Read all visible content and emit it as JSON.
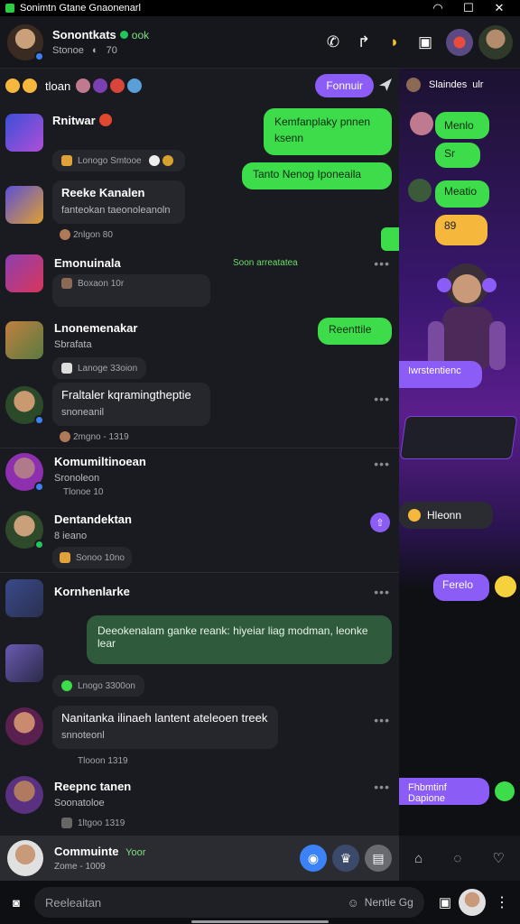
{
  "window": {
    "title": "Sonimtn Gtane Gnaonenarl"
  },
  "header": {
    "name": "Sonontkats",
    "tag": "ook",
    "subtitle": "Stonoe",
    "count": "70"
  },
  "filter": {
    "label": "tloan",
    "button": "Fonnuir"
  },
  "messages": [
    {
      "name": "Rnitwar",
      "meta": "Lonogo Smtooe"
    },
    {
      "name": "Reeke Kanalen",
      "sub": "fanteokan taeonoleanoln",
      "meta": "2nlgon 80"
    },
    {
      "name": "Emonuinala",
      "sub": "Soon arreatatea",
      "meta": "Boxaon 10r"
    },
    {
      "name": "Lnonemenakar",
      "sub": "Sbrafata",
      "meta": "Lanoge 33oion"
    },
    {
      "name": "Fraltaler kqramingtheptie",
      "sub": "snoneanil",
      "meta": "2mgno - 1319"
    },
    {
      "name": "Komumiltinoean",
      "sub": "Sronoleon",
      "meta": "Tlonoe 10"
    },
    {
      "name": "Dentandektan",
      "sub": "8 ieano",
      "meta": "Sonoo 10no"
    },
    {
      "name": "Kornhenlarke",
      "meta": "Lnogo 3300on"
    },
    {
      "name": "Nanitanka ilinaeh lantent ateleoen treek",
      "sub": "snnoteonl",
      "meta": "Tlooon 1319"
    },
    {
      "name": "Reepnc tanen",
      "sub": "Soonatoloe",
      "meta": "1ltgoo 1319"
    }
  ],
  "bubbles": {
    "b1": "Kemfanplaky pnnen ksenn",
    "b2": "Tanto Nenog Iponeaila",
    "b3": "Reenttile",
    "b4": "Deeokenalam ganke reank: hiyeiar liag modman, leonke lear"
  },
  "side": {
    "title": "Slaindes",
    "unit": "ulr",
    "b1": "Menlo",
    "b2": "Sr",
    "b3": "Meatio",
    "b4": "89",
    "b5": "Iwrstentienc",
    "b6": "Hleonn",
    "b7": "Ferelo",
    "b8": "Fhbmtinf Dapione"
  },
  "bottom": {
    "name": "Commuinte",
    "tag": "Yoor",
    "meta": "Zome - 1009"
  },
  "composer": {
    "placeholder": "Reeleaitan",
    "right": "Nentie Gg"
  }
}
